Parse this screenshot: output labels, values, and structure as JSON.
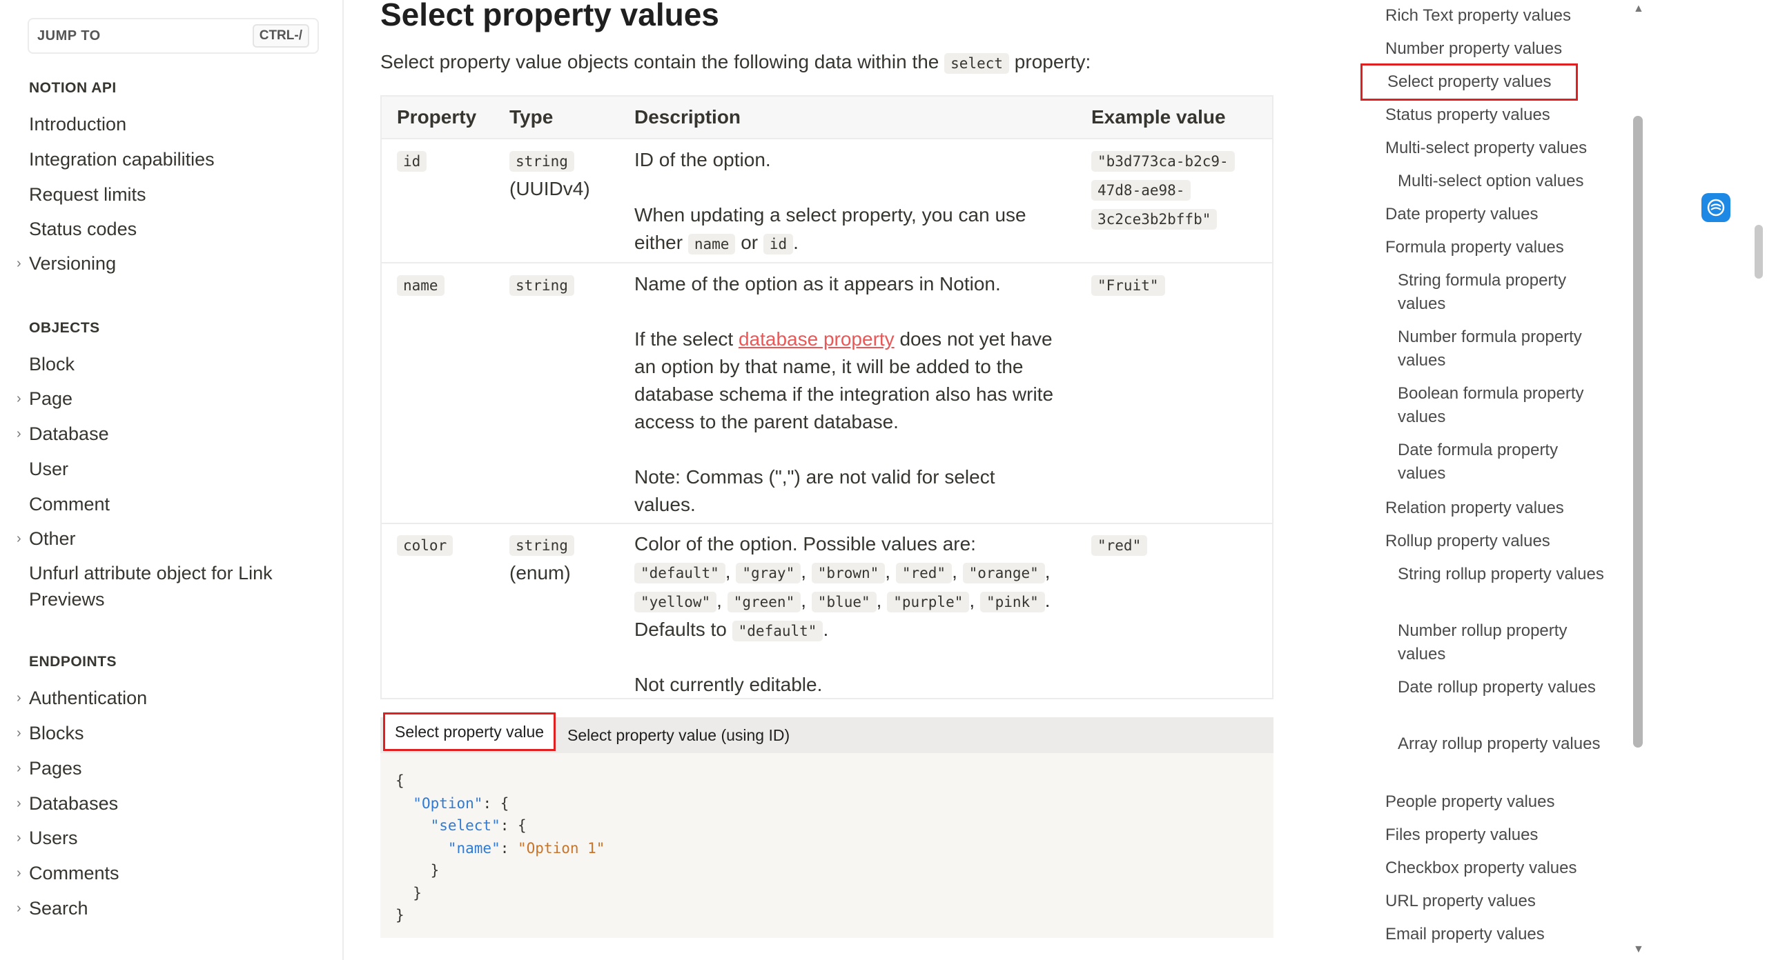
{
  "sidebar": {
    "jump_label": "JUMP TO",
    "jump_shortcut": "CTRL-/",
    "sections": [
      {
        "heading": "NOTION API",
        "items": [
          "Introduction",
          "Integration capabilities",
          "Request limits",
          "Status codes",
          "Versioning"
        ]
      },
      {
        "heading": "OBJECTS",
        "items": [
          "Block",
          "Page",
          "Database",
          "User",
          "Comment",
          "Other",
          "Unfurl attribute object for Link Previews"
        ]
      },
      {
        "heading": "ENDPOINTS",
        "items": [
          "Authentication",
          "Blocks",
          "Pages",
          "Databases",
          "Users",
          "Comments",
          "Search"
        ]
      }
    ]
  },
  "main": {
    "title": "Select property values",
    "intro_before": "Select property value objects contain the following data within the",
    "intro_code": "select",
    "intro_after": "property:",
    "table": {
      "headers": [
        "Property",
        "Type",
        "Description",
        "Example value"
      ],
      "rows": [
        {
          "property": "id",
          "type_code": "string",
          "type_extra": "(UUIDv4)",
          "desc1": "ID of the option.",
          "desc2_a": "When updating a select property, you can use",
          "desc2_b": "either",
          "desc2_code1": "name",
          "desc2_or": "or",
          "desc2_code2": "id",
          "desc2_end": ".",
          "example_lines": [
            "\"b3d773ca-b2c9-",
            "47d8-ae98-",
            "3c2ce3b2bffb\""
          ]
        },
        {
          "property": "name",
          "type_code": "string",
          "desc1": "Name of the option as it appears in Notion.",
          "desc2_pre": "If the select",
          "desc2_link": "database property",
          "desc2_post1": "does not yet have",
          "desc2_line2": "an option by that name, it will be added to the",
          "desc2_line3": "database schema if the integration also has write",
          "desc2_line4": "access to the parent database.",
          "desc3_line1": "Note: Commas (\",\") are not valid for select",
          "desc3_line2": "values.",
          "example": "\"Fruit\""
        },
        {
          "property": "color",
          "type_code": "string",
          "type_extra": "(enum)",
          "desc1": "Color of the option. Possible values are:",
          "colors_line1": [
            "\"default\"",
            "\"gray\"",
            "\"brown\"",
            "\"red\"",
            "\"orange\""
          ],
          "colors_line2": [
            "\"yellow\"",
            "\"green\"",
            "\"blue\"",
            "\"purple\"",
            "\"pink\""
          ],
          "defaults_text": "Defaults to",
          "defaults_code": "\"default\"",
          "defaults_end": ".",
          "desc_last": "Not currently editable.",
          "example": "\"red\""
        }
      ]
    },
    "tabs": [
      "Select property value",
      "Select property value (using ID)"
    ],
    "code_lines": [
      "{",
      "  \"Option\": {",
      "    \"select\": {",
      "      \"name\": \"Option 1\"",
      "    }",
      "  }",
      "}"
    ]
  },
  "toc": {
    "items": [
      {
        "label": "Rich Text property values",
        "sub": false
      },
      {
        "label": "Number property values",
        "sub": false
      },
      {
        "label": "Select property values",
        "sub": false,
        "active": true
      },
      {
        "label": "Status property values",
        "sub": false
      },
      {
        "label": "Multi-select property values",
        "sub": false
      },
      {
        "label": "Multi-select option values",
        "sub": true
      },
      {
        "label": "Date property values",
        "sub": false
      },
      {
        "label": "Formula property values",
        "sub": false
      },
      {
        "label": "String formula property values",
        "sub": true
      },
      {
        "label": "Number formula property values",
        "sub": true
      },
      {
        "label": "Boolean formula property values",
        "sub": true
      },
      {
        "label": "Date formula property values",
        "sub": true
      },
      {
        "label": "Relation property values",
        "sub": false
      },
      {
        "label": "Rollup property values",
        "sub": false
      },
      {
        "label": "String rollup property values",
        "sub": true
      },
      {
        "label": "Number rollup property values",
        "sub": true
      },
      {
        "label": "Date rollup property values",
        "sub": true
      },
      {
        "label": "Array rollup property values",
        "sub": true
      },
      {
        "label": "People property values",
        "sub": false
      },
      {
        "label": "Files property values",
        "sub": false
      },
      {
        "label": "Checkbox property values",
        "sub": false
      },
      {
        "label": "URL property values",
        "sub": false
      },
      {
        "label": "Email property values",
        "sub": false
      }
    ]
  },
  "colors": {
    "accent_red": "#e02020",
    "link_red": "#eb5757",
    "code_key": "#2f7ad4",
    "code_string": "#c9742b",
    "widget_blue": "#1e88e5"
  }
}
